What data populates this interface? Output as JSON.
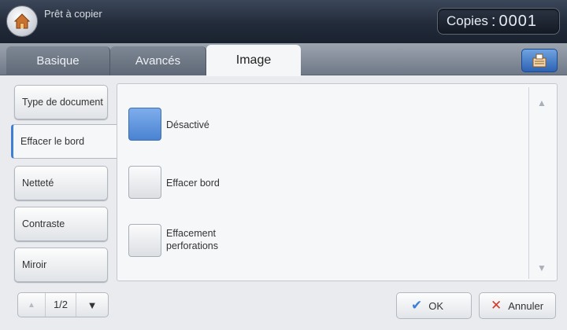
{
  "header": {
    "title": "Prêt à copier",
    "copies_label": "Copies",
    "copies_sep": ":",
    "copies_value": "0001"
  },
  "tabs": [
    {
      "label": "Basique"
    },
    {
      "label": "Avancés"
    },
    {
      "label": "Image"
    }
  ],
  "active_tab": "Image",
  "sidebar": {
    "items": [
      {
        "label": "Type de document"
      },
      {
        "label": "Effacer le bord"
      },
      {
        "label": "Netteté"
      },
      {
        "label": "Contraste"
      },
      {
        "label": "Miroir"
      }
    ],
    "active_item": "Effacer le bord"
  },
  "options": [
    {
      "label": "Désactivé",
      "selected": true
    },
    {
      "label": "Effacer bord",
      "selected": false
    },
    {
      "label": "Effacement perforations",
      "selected": false
    }
  ],
  "pager": {
    "page": "1/2"
  },
  "buttons": {
    "ok": "OK",
    "cancel": "Annuler"
  },
  "colors": {
    "accent": "#4a83d2",
    "header": "#222b39"
  },
  "icons": [
    "home-icon",
    "job-status-icon",
    "scroll-up-icon",
    "scroll-down-icon",
    "page-up-icon",
    "page-down-icon",
    "check-icon",
    "cancel-x-icon"
  ]
}
